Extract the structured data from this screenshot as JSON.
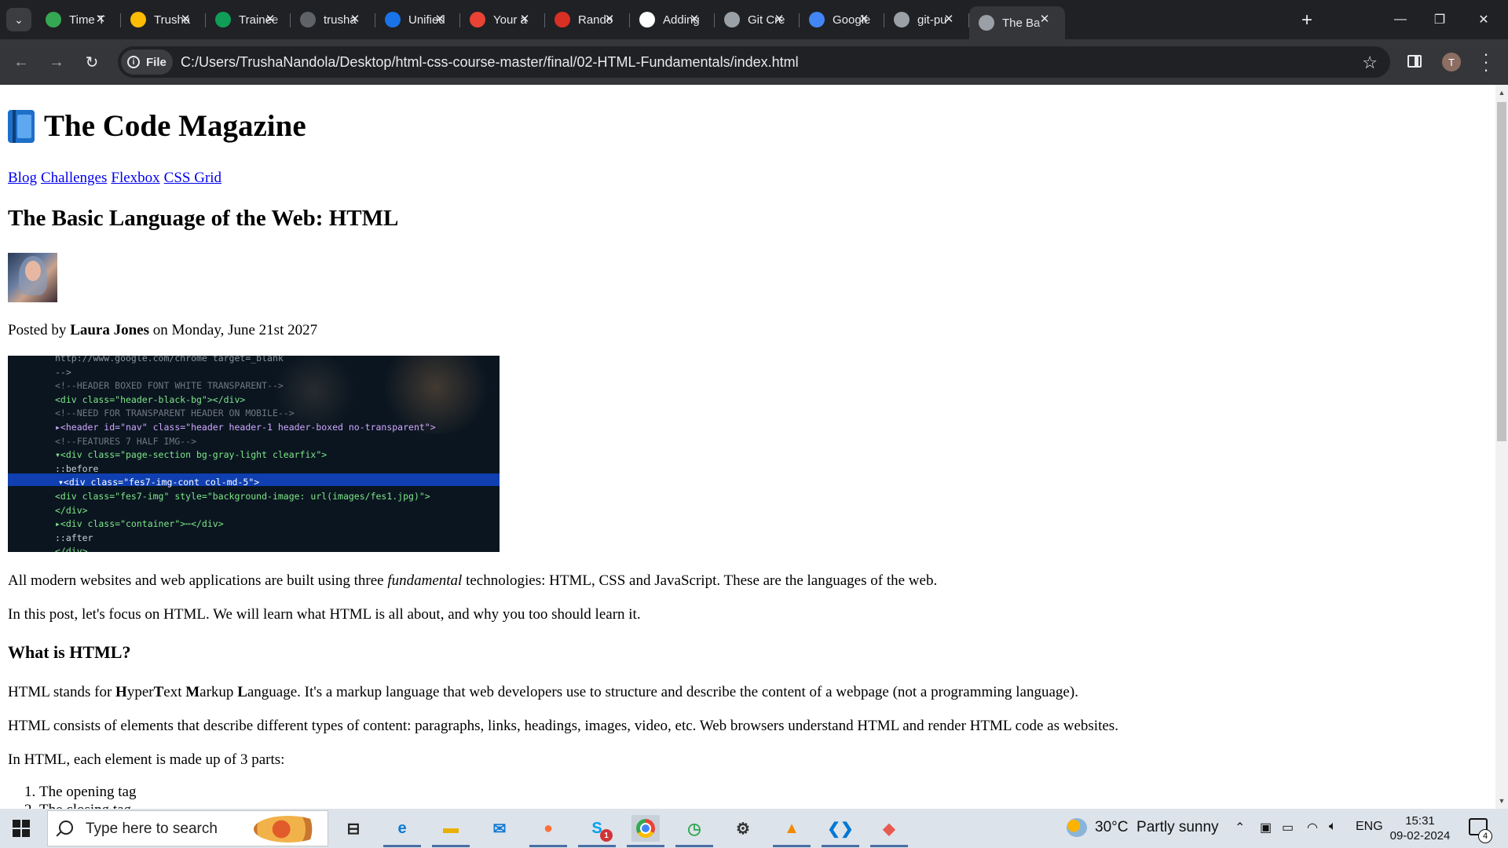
{
  "browser": {
    "tabs": [
      {
        "title": "Time T",
        "favicon": "timer-icon",
        "color": "#34a853"
      },
      {
        "title": "Trusha",
        "favicon": "google-drive-icon",
        "color": "#fbbc04"
      },
      {
        "title": "Trainee",
        "favicon": "google-sheets-icon",
        "color": "#0f9d58"
      },
      {
        "title": "trusha",
        "favicon": "loading-icon",
        "color": "#5f6368"
      },
      {
        "title": "Unified",
        "favicon": "unified-icon",
        "color": "#1a73e8"
      },
      {
        "title": "Your a",
        "favicon": "gmail-icon",
        "color": "#ea4335"
      },
      {
        "title": "Rando",
        "favicon": "random-icon",
        "color": "#d93025"
      },
      {
        "title": "Adding",
        "favicon": "github-icon",
        "color": "#ffffff"
      },
      {
        "title": "Git Cre",
        "favicon": "globe-icon",
        "color": "#9aa0a6"
      },
      {
        "title": "Google",
        "favicon": "google-icon",
        "color": "#4285f4"
      },
      {
        "title": "git-pu",
        "favicon": "globe-icon",
        "color": "#9aa0a6"
      },
      {
        "title": "The Ba",
        "favicon": "globe-icon",
        "color": "#9aa0a6",
        "active": true
      }
    ],
    "new_tab_label": "+",
    "url_chip": "File",
    "url": "C:/Users/TrushaNandola/Desktop/html-css-course-master/final/02-HTML-Fundamentals/index.html",
    "profile_initial": "T"
  },
  "page": {
    "title": "The Code Magazine",
    "nav": [
      "Blog",
      "Challenges",
      "Flexbox",
      "CSS Grid"
    ],
    "heading": "The Basic Language of the Web: HTML",
    "posted_prefix": "Posted by ",
    "author": "Laura Jones",
    "posted_suffix": " on Monday, June 21st 2027",
    "code_lines": [
      "   http://www.google.com/chrome  target=_blank",
      " -->",
      " <!--HEADER BOXED FONT WHITE TRANSPARENT-->",
      " <div class=\"header-black-bg\"></div>",
      " <!--NEED FOR TRANSPARENT HEADER ON MOBILE-->",
      "▸<header id=\"nav\" class=\"header header-1 header-boxed no-transparent\">",
      " <!--FEATURES 7 HALF IMG-->",
      "▾<div class=\"page-section bg-gray-light clearfix\">",
      "   ::before",
      "  ▾<div class=\"fes7-img-cont col-md-5\">",
      "     <div class=\"fes7-img\" style=\"background-image: url(images/fes1.jpg)\">",
      "   </div>",
      "  ▸<div class=\"container\">⋯</div>",
      "   ::after",
      " </div>"
    ],
    "intro_1_a": "All modern websites and web applications are built using three ",
    "intro_1_em": "fundamental",
    "intro_1_b": " technologies: HTML, CSS and JavaScript. These are the languages of the web.",
    "intro_2": "In this post, let's focus on HTML. We will learn what HTML is all about, and why you too should learn it.",
    "what_heading": "What is HTML?",
    "html_def_a": "HTML stands for ",
    "html_def_h": "H",
    "html_def_yper": "yper",
    "html_def_t": "T",
    "html_def_ext": "ext ",
    "html_def_m": "M",
    "html_def_arkup": "arkup ",
    "html_def_l": "L",
    "html_def_b": "anguage. It's a markup language that web developers use to structure and describe the content of a webpage (not a programming language).",
    "html_consists": "HTML consists of elements that describe different types of content: paragraphs, links, headings, images, video, etc. Web browsers understand HTML and render HTML code as websites.",
    "element_parts": "In HTML, each element is made up of 3 parts:",
    "parts": [
      "The opening tag",
      "The closing tag"
    ]
  },
  "taskbar": {
    "search_placeholder": "Type here to search",
    "apps": [
      "task-view-icon",
      "edge-icon",
      "file-explorer-icon",
      "mail-icon",
      "firefox-icon",
      "skype-icon",
      "chrome-icon",
      "timer-icon",
      "settings-icon",
      "vlc-icon",
      "vscode-icon",
      "git-icon"
    ],
    "skype_badge": "1",
    "weather_temp": "30°C",
    "weather_desc": "Partly sunny",
    "language": "ENG",
    "time": "15:31",
    "date": "09-02-2024",
    "notification_count": "4"
  }
}
